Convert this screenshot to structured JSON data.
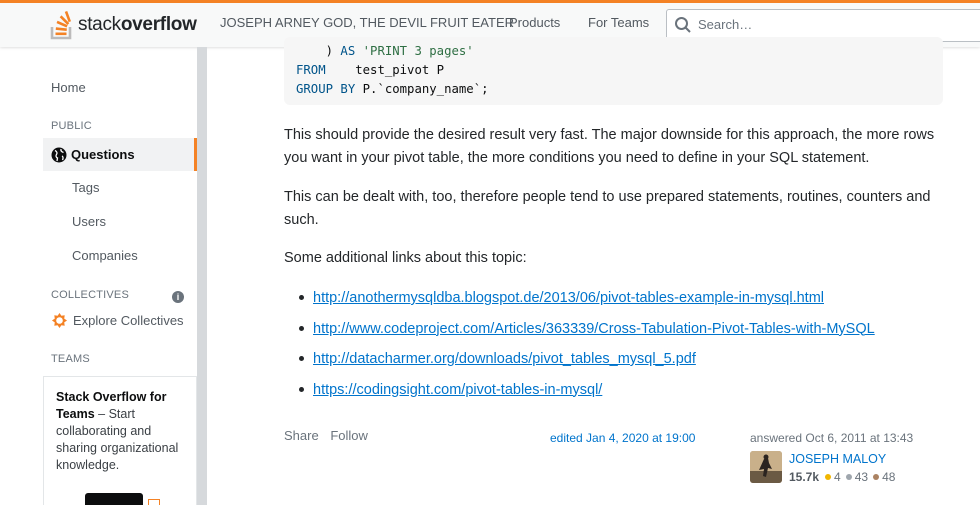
{
  "header": {
    "logo_text_light": "stack",
    "logo_text_bold": "overflow",
    "user_label": "JOSEPH ARNEY GOD, THE DEVIL FRUIT EATER",
    "products_label": "Products",
    "for_teams_label": "For Teams",
    "search_placeholder": "Search…"
  },
  "sidebar": {
    "home": "Home",
    "public_heading": "PUBLIC",
    "questions": "Questions",
    "tags": "Tags",
    "users": "Users",
    "companies": "Companies",
    "collectives_heading": "COLLECTIVES",
    "explore_collectives": "Explore Collectives",
    "teams_heading": "TEAMS",
    "teams_title": "Stack Overflow for Teams",
    "teams_text": "– Start collaborating and sharing organizational knowledge."
  },
  "code": {
    "line1_a": "    ) ",
    "line1_kw": "AS",
    "line1_str": "'PRINT 3 pages'",
    "line2_kw": "FROM",
    "line2_rest": "    test_pivot P",
    "line3_kw": "GROUP BY",
    "line3_rest": " P.`company_name`;"
  },
  "answer": {
    "para1": "This should provide the desired result very fast. The major downside for this approach, the more rows you want in your pivot table, the more conditions you need to define in your SQL statement.",
    "para2": "This can be dealt with, too, therefore people tend to use prepared statements, routines, counters and such.",
    "para3": "Some additional links about this topic:",
    "links": [
      "http://anothermysqldba.blogspot.de/2013/06/pivot-tables-example-in-mysql.html",
      "http://www.codeproject.com/Articles/363339/Cross-Tabulation-Pivot-Tables-with-MySQL",
      "http://datacharmer.org/downloads/pivot_tables_mysql_5.pdf",
      "https://codingsight.com/pivot-tables-in-mysql/"
    ]
  },
  "post_menu": {
    "share": "Share",
    "follow": "Follow",
    "edited": "edited Jan 4, 2020 at 19:00",
    "answered": "answered Oct 6, 2011 at 13:43",
    "username": "JOSEPH MALOY",
    "reputation": "15.7k",
    "gold": "4",
    "silver": "43",
    "bronze": "48"
  },
  "colors": {
    "accent": "#f48225",
    "link": "#0074cc"
  }
}
